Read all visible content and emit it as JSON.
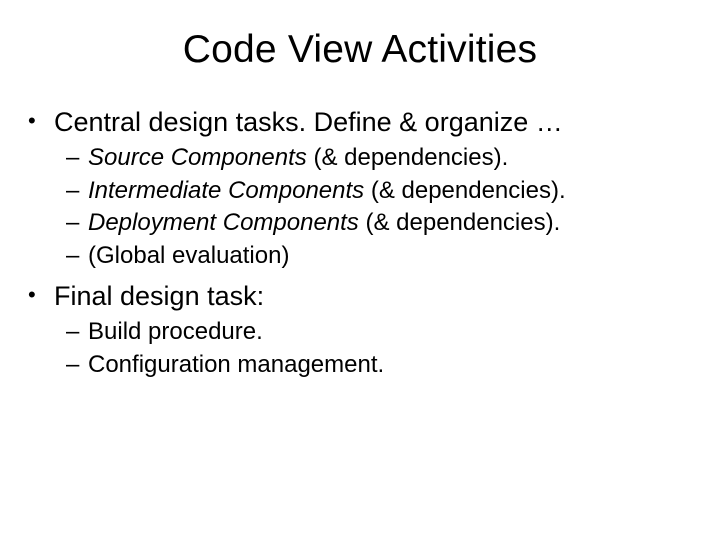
{
  "title": "Code View Activities",
  "bullets": {
    "b1": "Central design tasks. Define & organize …",
    "b1_sub": [
      {
        "em": "Source Components",
        "rest": " (& dependencies)."
      },
      {
        "em": "Intermediate Components",
        "rest": " (& dependencies)."
      },
      {
        "em": "Deployment Components",
        "rest": " (& dependencies)."
      },
      {
        "em": "",
        "rest": "(Global evaluation)"
      }
    ],
    "b2": "Final design task:",
    "b2_sub": [
      "Build procedure.",
      "Configuration management."
    ]
  }
}
